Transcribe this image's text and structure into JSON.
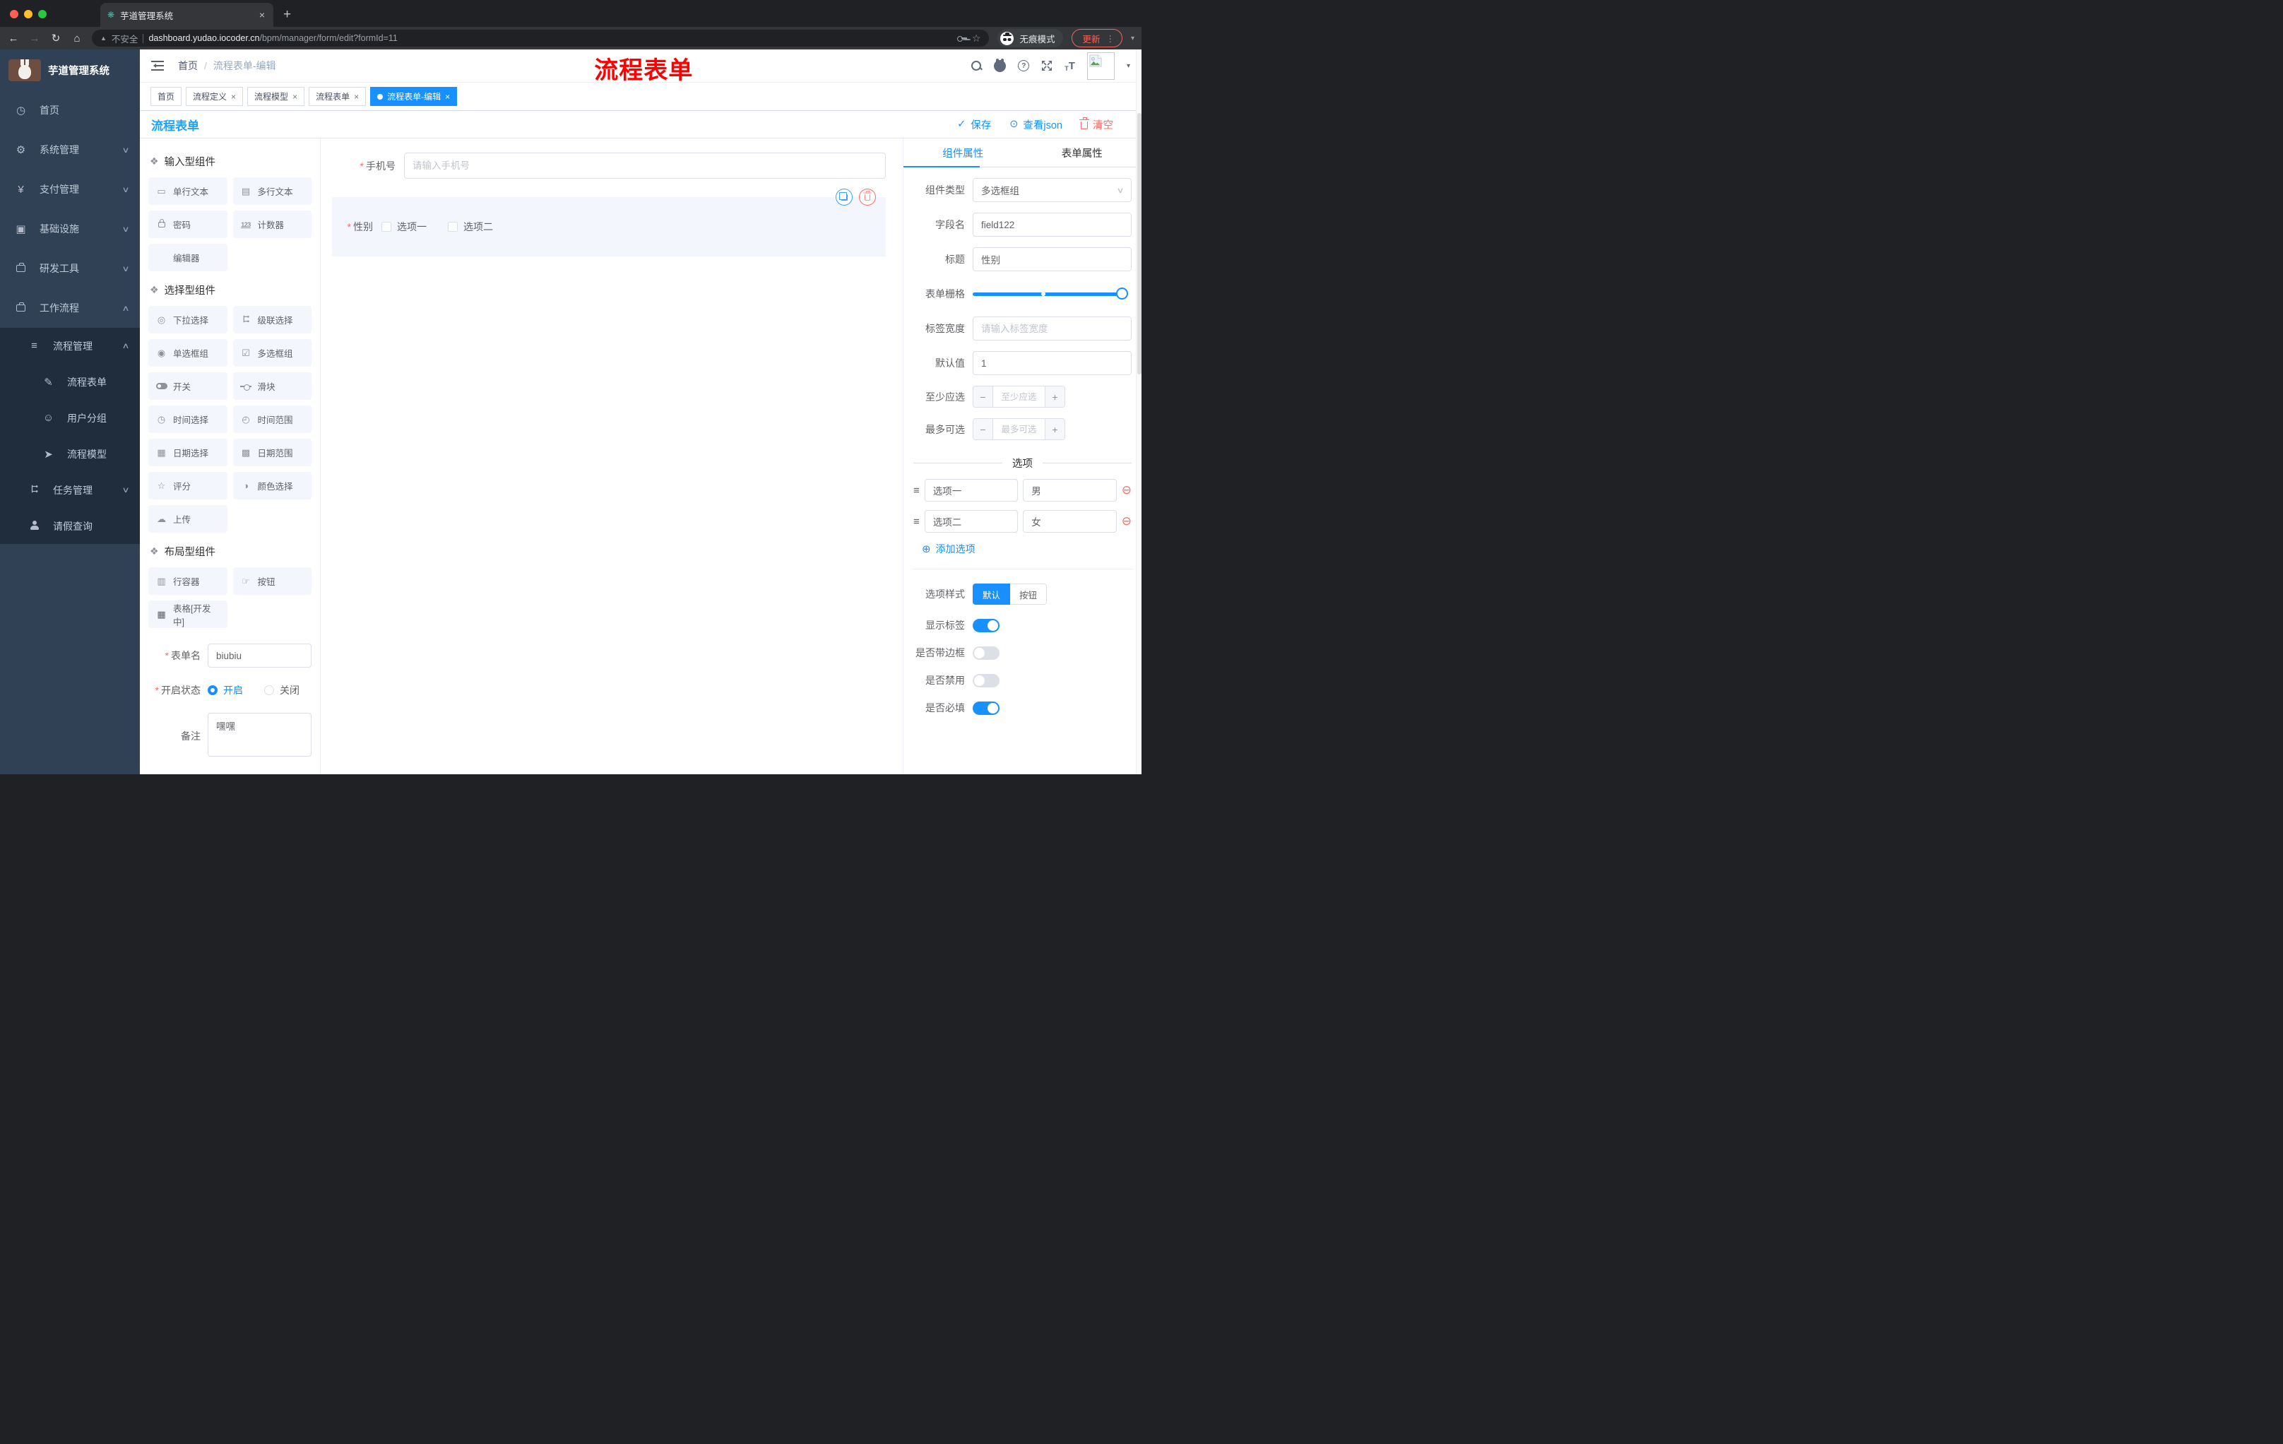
{
  "browser": {
    "tab_title": "芋道管理系统",
    "not_secure": "不安全",
    "url_host": "dashboard.yudao.iocoder.cn",
    "url_path": "/bpm/manager/form/edit?formId=11",
    "incognito_label": "无痕模式",
    "update_label": "更新"
  },
  "icons": {
    "back": "←",
    "forward": "→",
    "reload": "↻",
    "home": "⌂",
    "warning": "▲",
    "star": "☆",
    "more_vertical": "⋮",
    "caret_down": "▾",
    "tab_close": "×",
    "new_tab": "+",
    "favicon": "❋",
    "breadcrumb_sep": "/",
    "question": "?",
    "text_small": "T",
    "text_big": "T",
    "check": "✓",
    "eye": "⊙",
    "puzzle": "❖",
    "input_box": "▭",
    "textarea_box": "▤",
    "select_circle": "◎",
    "radio": "◉",
    "checkbox": "☑",
    "clock": "◷",
    "clock_range": "◴",
    "calendar": "▦",
    "calendar_range": "▩",
    "rate_star": "☆",
    "color_circle": "◑",
    "upload_cloud": "☁",
    "row_container": "▥",
    "button_hand": "☞",
    "table_grid": "▦",
    "dashboard": "◷",
    "gear": "⚙",
    "yen": "¥",
    "monitor": "▣",
    "list": "≡",
    "doc_edit": "✎",
    "robot": "☺",
    "plane": "➤",
    "drag": "≡",
    "minus_circle": "⊖",
    "plus_circle": "⊕",
    "minus": "−",
    "plus": "+",
    "chevron_down": "∨",
    "chevron_up": "∧"
  },
  "ui": {
    "required_mark": "*"
  },
  "sidebar": {
    "logo_title": "芋道管理系统",
    "items": [
      {
        "label": "首页"
      },
      {
        "label": "系统管理"
      },
      {
        "label": "支付管理"
      },
      {
        "label": "基础设施"
      },
      {
        "label": "研发工具"
      },
      {
        "label": "工作流程"
      }
    ],
    "submenu": [
      {
        "label": "流程管理"
      },
      {
        "label": "流程表单"
      },
      {
        "label": "用户分组"
      },
      {
        "label": "流程模型"
      },
      {
        "label": "任务管理"
      },
      {
        "label": "请假查询"
      }
    ]
  },
  "header": {
    "breadcrumb_home": "首页",
    "breadcrumb_current": "流程表单-编辑",
    "watermark": "流程表单"
  },
  "page_tabs": [
    {
      "label": "首页"
    },
    {
      "label": "流程定义"
    },
    {
      "label": "流程模型"
    },
    {
      "label": "流程表单"
    },
    {
      "label": "流程表单-编辑"
    }
  ],
  "toolbar": {
    "title": "流程表单",
    "save": "保存",
    "view_json": "查看json",
    "clear": "清空"
  },
  "palette": {
    "sections": [
      {
        "title": "输入型组件",
        "items": [
          {
            "label": "单行文本"
          },
          {
            "label": "多行文本"
          },
          {
            "label": "密码"
          },
          {
            "label": "计数器",
            "icon_text": "123"
          },
          {
            "label": "编辑器"
          }
        ]
      },
      {
        "title": "选择型组件",
        "items": [
          {
            "label": "下拉选择"
          },
          {
            "label": "级联选择"
          },
          {
            "label": "单选框组"
          },
          {
            "label": "多选框组"
          },
          {
            "label": "开关"
          },
          {
            "label": "滑块"
          },
          {
            "label": "时间选择"
          },
          {
            "label": "时间范围"
          },
          {
            "label": "日期选择"
          },
          {
            "label": "日期范围"
          },
          {
            "label": "评分"
          },
          {
            "label": "颜色选择"
          },
          {
            "label": "上传"
          }
        ]
      },
      {
        "title": "布局型组件",
        "items": [
          {
            "label": "行容器"
          },
          {
            "label": "按钮"
          },
          {
            "label": "表格[开发中]"
          }
        ]
      }
    ],
    "form": {
      "name_label": "表单名",
      "name_value": "biubiu",
      "status_label": "开启状态",
      "status_on": "开启",
      "status_off": "关闭",
      "remark_label": "备注",
      "remark_value": "嘿嘿"
    }
  },
  "canvas": {
    "phone_label": "手机号",
    "phone_placeholder": "请输入手机号",
    "gender_label": "性别",
    "gender_options": [
      {
        "label": "选项一"
      },
      {
        "label": "选项二"
      }
    ]
  },
  "inspector": {
    "tab_component": "组件属性",
    "tab_form": "表单属性",
    "type_label": "组件类型",
    "type_value": "多选框组",
    "field_label": "字段名",
    "field_value": "field122",
    "title_label": "标题",
    "title_value": "性别",
    "grid_label": "表单栅格",
    "label_width_label": "标签宽度",
    "label_width_placeholder": "请输入标签宽度",
    "default_label": "默认值",
    "default_value": "1",
    "min_label": "至少应选",
    "min_placeholder": "至少应选",
    "max_label": "最多可选",
    "max_placeholder": "最多可选",
    "options_title": "选项",
    "options": [
      {
        "label": "选项一",
        "value": "男"
      },
      {
        "label": "选项二",
        "value": "女"
      }
    ],
    "add_option": "添加选项",
    "style_label": "选项样式",
    "style_default": "默认",
    "style_button": "按钮",
    "toggles": [
      {
        "label": "显示标签",
        "on": true
      },
      {
        "label": "是否带边框",
        "on": false
      },
      {
        "label": "是否禁用",
        "on": false
      },
      {
        "label": "是否必填",
        "on": true
      }
    ]
  },
  "colors": {
    "primary": "#1890ff",
    "danger": "#f56c6c",
    "sidebar_bg": "#304156",
    "submenu_bg": "#1f2d3d",
    "title_blue": "#19a3ff",
    "watermark_red": "#ff0000"
  }
}
